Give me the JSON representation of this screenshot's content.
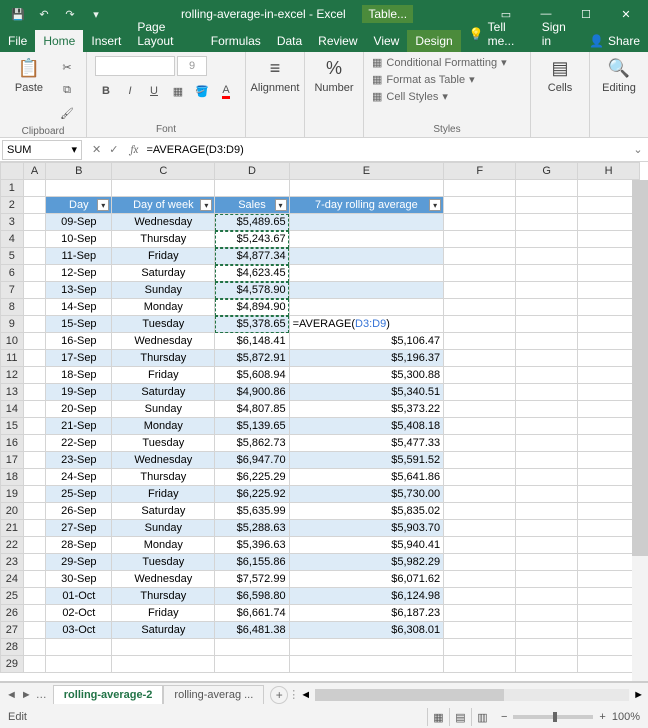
{
  "title": {
    "filename": "rolling-average-in-excel",
    "app": "Excel",
    "context": "Table..."
  },
  "tabs": {
    "file": "File",
    "home": "Home",
    "insert": "Insert",
    "pagelayout": "Page Layout",
    "formulas": "Formulas",
    "data": "Data",
    "review": "Review",
    "view": "View",
    "design": "Design",
    "tellme": "Tell me...",
    "signin": "Sign in",
    "share": "Share"
  },
  "ribbon": {
    "clipboard": {
      "paste": "Paste",
      "label": "Clipboard"
    },
    "font": {
      "size": "9",
      "label": "Font",
      "bold": "B",
      "italic": "I",
      "underline": "U"
    },
    "alignment": {
      "btn": "Alignment",
      "label": ""
    },
    "number": {
      "btn": "Number",
      "pct": "%",
      "label": ""
    },
    "styles": {
      "cond": "Conditional Formatting",
      "fmt": "Format as Table",
      "cell": "Cell Styles",
      "label": "Styles"
    },
    "cells": {
      "btn": "Cells"
    },
    "editing": {
      "btn": "Editing"
    }
  },
  "formula_bar": {
    "namebox": "SUM",
    "formula": "=AVERAGE(D3:D9)"
  },
  "columns": [
    "",
    "A",
    "B",
    "C",
    "D",
    "E",
    "F",
    "G",
    "H"
  ],
  "headers": {
    "day": "Day",
    "dow": "Day of week",
    "sales": "Sales",
    "avg": "7-day rolling average"
  },
  "active_cell_formula": "=AVERAGE(D3:D9)",
  "rows": [
    {
      "n": 3,
      "day": "09-Sep",
      "dow": "Wednesday",
      "sales": "$5,489.65",
      "avg": ""
    },
    {
      "n": 4,
      "day": "10-Sep",
      "dow": "Thursday",
      "sales": "$5,243.67",
      "avg": ""
    },
    {
      "n": 5,
      "day": "11-Sep",
      "dow": "Friday",
      "sales": "$4,877.34",
      "avg": ""
    },
    {
      "n": 6,
      "day": "12-Sep",
      "dow": "Saturday",
      "sales": "$4,623.45",
      "avg": ""
    },
    {
      "n": 7,
      "day": "13-Sep",
      "dow": "Sunday",
      "sales": "$4,578.90",
      "avg": ""
    },
    {
      "n": 8,
      "day": "14-Sep",
      "dow": "Monday",
      "sales": "$4,894.90",
      "avg": ""
    },
    {
      "n": 9,
      "day": "15-Sep",
      "dow": "Tuesday",
      "sales": "$5,378.65",
      "avg": "=AVERAGE(D3:D9)"
    },
    {
      "n": 10,
      "day": "16-Sep",
      "dow": "Wednesday",
      "sales": "$6,148.41",
      "avg": "$5,106.47"
    },
    {
      "n": 11,
      "day": "17-Sep",
      "dow": "Thursday",
      "sales": "$5,872.91",
      "avg": "$5,196.37"
    },
    {
      "n": 12,
      "day": "18-Sep",
      "dow": "Friday",
      "sales": "$5,608.94",
      "avg": "$5,300.88"
    },
    {
      "n": 13,
      "day": "19-Sep",
      "dow": "Saturday",
      "sales": "$4,900.86",
      "avg": "$5,340.51"
    },
    {
      "n": 14,
      "day": "20-Sep",
      "dow": "Sunday",
      "sales": "$4,807.85",
      "avg": "$5,373.22"
    },
    {
      "n": 15,
      "day": "21-Sep",
      "dow": "Monday",
      "sales": "$5,139.65",
      "avg": "$5,408.18"
    },
    {
      "n": 16,
      "day": "22-Sep",
      "dow": "Tuesday",
      "sales": "$5,862.73",
      "avg": "$5,477.33"
    },
    {
      "n": 17,
      "day": "23-Sep",
      "dow": "Wednesday",
      "sales": "$6,947.70",
      "avg": "$5,591.52"
    },
    {
      "n": 18,
      "day": "24-Sep",
      "dow": "Thursday",
      "sales": "$6,225.29",
      "avg": "$5,641.86"
    },
    {
      "n": 19,
      "day": "25-Sep",
      "dow": "Friday",
      "sales": "$6,225.92",
      "avg": "$5,730.00"
    },
    {
      "n": 20,
      "day": "26-Sep",
      "dow": "Saturday",
      "sales": "$5,635.99",
      "avg": "$5,835.02"
    },
    {
      "n": 21,
      "day": "27-Sep",
      "dow": "Sunday",
      "sales": "$5,288.63",
      "avg": "$5,903.70"
    },
    {
      "n": 22,
      "day": "28-Sep",
      "dow": "Monday",
      "sales": "$5,396.63",
      "avg": "$5,940.41"
    },
    {
      "n": 23,
      "day": "29-Sep",
      "dow": "Tuesday",
      "sales": "$6,155.86",
      "avg": "$5,982.29"
    },
    {
      "n": 24,
      "day": "30-Sep",
      "dow": "Wednesday",
      "sales": "$7,572.99",
      "avg": "$6,071.62"
    },
    {
      "n": 25,
      "day": "01-Oct",
      "dow": "Thursday",
      "sales": "$6,598.80",
      "avg": "$6,124.98"
    },
    {
      "n": 26,
      "day": "02-Oct",
      "dow": "Friday",
      "sales": "$6,661.74",
      "avg": "$6,187.23"
    },
    {
      "n": 27,
      "day": "03-Oct",
      "dow": "Saturday",
      "sales": "$6,481.38",
      "avg": "$6,308.01"
    }
  ],
  "sheets": {
    "active": "rolling-average-2",
    "other": "rolling-averag ..."
  },
  "status": {
    "mode": "Edit",
    "zoom": "100%"
  }
}
